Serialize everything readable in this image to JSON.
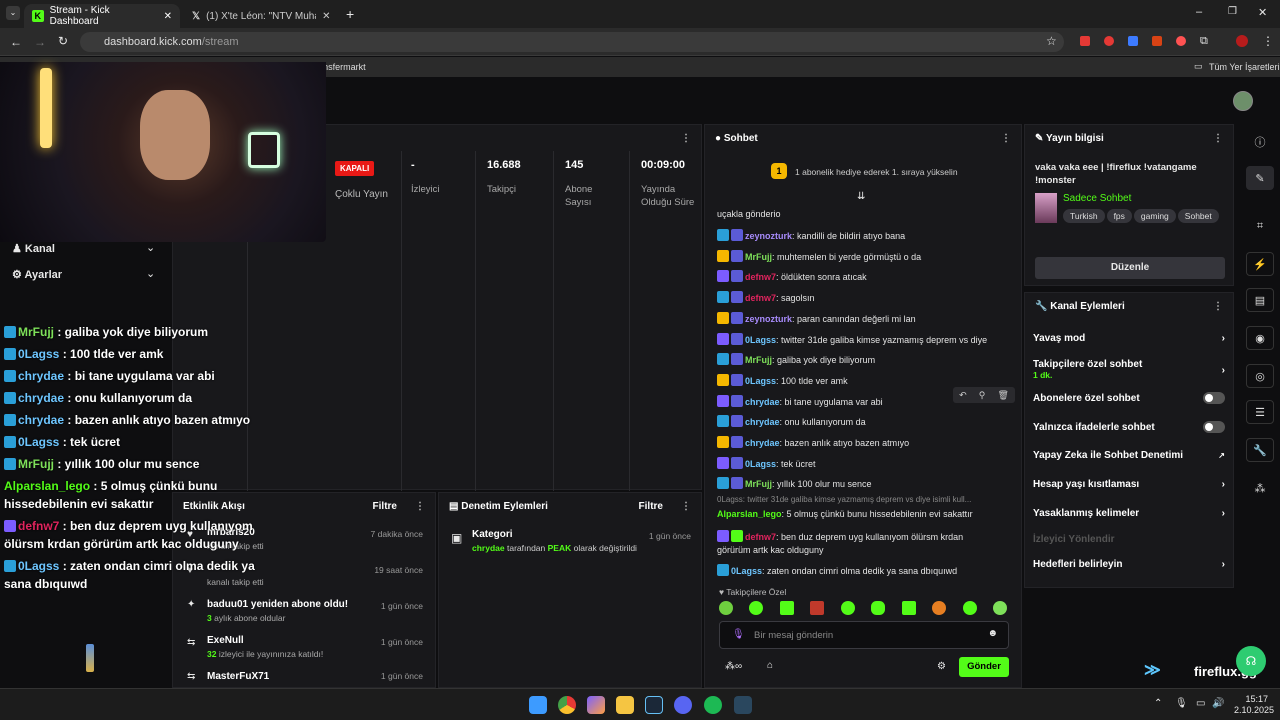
{
  "browser": {
    "tabs": [
      {
        "label": "Stream - Kick Dashboard"
      },
      {
        "label": "(1) X'te Léon: \"NTV Muhabiri Ha"
      }
    ],
    "url_host": "dashboard.kick.com",
    "url_path": "/stream",
    "bookmark": "Transfermarkt",
    "bookmarks_all": "Tüm Yer İşaretleri"
  },
  "stream": {
    "status": "KAPALI",
    "multi": "Çoklu Yayın",
    "viewers_v": "-",
    "viewers_l": "İzleyici",
    "followers_v": "16.688",
    "followers_l": "Takipçi",
    "subs_v": "145",
    "subs_l": "Abone Sayısı",
    "duration_v": "00:09:00",
    "duration_l": "Yayında Olduğu Süre"
  },
  "left_menu": {
    "channel": "Kanal",
    "settings": "Ayarlar"
  },
  "activity": {
    "title": "Etkinlik Akışı",
    "filter": "Filtre",
    "items": [
      {
        "name": "mrbaris20",
        "sub": "kanalı takip etti",
        "time": "7 dakika önce"
      },
      {
        "name": "",
        "sub": "kanalı takip etti",
        "time": "19 saat önce"
      },
      {
        "name": "baduu01 yeniden abone oldu!",
        "sub_n": "3",
        "sub": "aylık abone oldular",
        "time": "1 gün önce"
      },
      {
        "name": "ExeNull",
        "sub_n": "32",
        "sub": "izleyici ile yayınınıza katıldı!",
        "time": "1 gün önce"
      },
      {
        "name": "MasterFuX71",
        "time": "1 gün önce"
      }
    ]
  },
  "moderation": {
    "title": "Denetim Eylemleri",
    "filter": "Filtre",
    "item_title": "Kategori",
    "item_user": "chrydae",
    "item_mid": "tarafından",
    "item_val": "PEAK",
    "item_end": "olarak değiştirildi",
    "time": "1 gün önce"
  },
  "chat": {
    "title": "Sohbet",
    "banner_n": "1",
    "banner": "1 abonelik hediye ederek 1. sıraya yükselin",
    "first": "uçakla gönderio",
    "messages": [
      {
        "user": "zeynozturk",
        "text": "kandilli de bildiri atıyo bana",
        "color": "#a78bfa"
      },
      {
        "user": "MrFujj",
        "text": "muhtemelen bi yerde görmüştü o da",
        "color": "#7ee05a"
      },
      {
        "user": "defnw7",
        "text": "öldükten sonra atıcak",
        "color": "#e0245e"
      },
      {
        "user": "defnw7",
        "text": "sagolsın",
        "color": "#e0245e"
      },
      {
        "user": "zeynozturk",
        "text": "paran canından değerli mi lan",
        "color": "#a78bfa"
      },
      {
        "user": "0Lagss",
        "text": "twitter 31de galiba kimse yazmamış deprem vs diye",
        "color": "#6ec6ff"
      },
      {
        "user": "MrFujj",
        "text": "galiba yok diye biliyorum",
        "color": "#7ee05a"
      },
      {
        "user": "0Lagss",
        "text": "100 tlde ver amk",
        "color": "#6ec6ff"
      },
      {
        "user": "chrydae",
        "text": "bi tane uygulama var abi",
        "color": "#6ec6ff"
      },
      {
        "user": "chrydae",
        "text": "onu kullanıyorum da",
        "color": "#6ec6ff"
      },
      {
        "user": "chrydae",
        "text": "bazen anlık atıyo bazen atmıyo",
        "color": "#6ec6ff"
      },
      {
        "user": "0Lagss",
        "text": "tek ücret",
        "color": "#6ec6ff"
      },
      {
        "user": "MrFujj",
        "text": "yıllık 100 olur mu sence",
        "color": "#7ee05a"
      }
    ],
    "reply": "0Lagss: twitter 31de galiba kimse yazmamış deprem vs diye isimli kull...",
    "m_alp_user": "Alparslan_lego",
    "m_alp": "5 olmuş çünkü bunu hissedebilenin evi sakattır",
    "m_def_user": "defnw7",
    "m_def": "ben duz deprem uyg kullanıyom ölürsm krdan görürüm artk kac olduguny",
    "m_last_user": "0Lagss",
    "m_last": "zaten ondan cimri olma dedik ya sana dbıquıwd",
    "followers_only": "Takipçilere Özel",
    "placeholder": "Bir mesaj gönderin",
    "send": "Gönder"
  },
  "info": {
    "title": "Yayın bilgisi",
    "stream_title": "vaka vaka eee | !fireflux !vatangame !monster",
    "category": "Sadece Sohbet",
    "tags": [
      "Turkish",
      "fps",
      "gaming",
      "Sohbet"
    ],
    "edit": "Düzenle"
  },
  "actions": {
    "title": "Kanal Eylemleri",
    "slow": "Yavaş mod",
    "followers": "Takipçilere özel sohbet",
    "followers_sub": "1 dk.",
    "subs": "Abonelere özel sohbet",
    "emotes": "Yalnızca ifadelerle sohbet",
    "ai": "Yapay Zeka ile Sohbet Denetimi",
    "age": "Hesap yaşı kısıtlaması",
    "banned": "Yasaklanmış kelimeler",
    "raid": "İzleyici Yönlendir",
    "goals": "Hedefleri belirleyin"
  },
  "overlay": {
    "lines": [
      {
        "user": "MrFujj",
        "text": "galiba yok diye biliyorum",
        "color": "#7ee05a"
      },
      {
        "user": "0Lagss",
        "text": "100 tlde ver amk",
        "color": "#6ec6ff"
      },
      {
        "user": "chrydae",
        "text": "bi tane uygulama var abi",
        "color": "#6ec6ff"
      },
      {
        "user": "chrydae",
        "text": "onu kullanıyorum da",
        "color": "#6ec6ff"
      },
      {
        "user": "chrydae",
        "text": "bazen anlık atıyo bazen atmıyo",
        "color": "#6ec6ff"
      },
      {
        "user": "0Lagss",
        "text": "tek ücret",
        "color": "#6ec6ff"
      },
      {
        "user": "MrFujj",
        "text": "yıllık 100 olur mu sence",
        "color": "#7ee05a"
      }
    ],
    "alp_user": "Alparslan_lego",
    "alp_1": "5 olmuş çünkü bunu",
    "alp_2": "hissedebilenin evi sakattır",
    "def_user": "defnw7",
    "def_1": "ben duz deprem uyg kullanıyom",
    "def_2": "ölürsm krdan görürüm artk kac olduguny",
    "last_user": "0Lagss",
    "last_1": "zaten ondan cimri olma dedik ya",
    "last_2": "sana dbıquıwd",
    "brand": "fireflux.gg"
  },
  "taskbar": {
    "time": "15:17",
    "date": "2.10.2025"
  }
}
